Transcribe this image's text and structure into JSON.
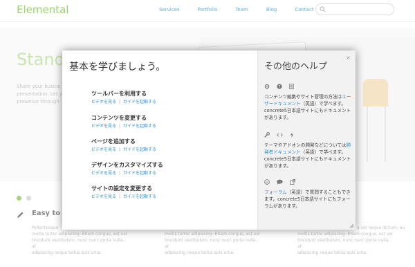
{
  "site": {
    "logo": "Elemental",
    "nav": [
      "Services",
      "Portfolio",
      "Team",
      "Blog",
      "Contact"
    ],
    "hero_title": "Stand O",
    "hero_lines": [
      "Share your busine",
      "presentation. Let y",
      "presence through"
    ],
    "feature_heading": "Easy to I",
    "columns": [
      [
        "Pellentesque",
        "mollis tortor adipiscing. Etiam congue, est vel",
        "tincidunt vestibulum, nunc nunc porta nulla, at",
        "adipiscing neque tellus quis urna."
      ],
      [
        "mollis tortor adipiscing. Etiam congue, est vel",
        "tincidunt vestibulum, nunc nunc porta nulla, at",
        "adipiscing neque tellus quis urna."
      ],
      [
        "mollis tortor adipiscing. Etiam congue, est vel",
        "tincidunt vestibulum, nunc nunc porta nulla, at",
        "adipiscing neque tellus quis urna."
      ],
      [
        "a vel neque dictum, eu",
        "mollis tortor adipiscing. Etiam congue, est vel",
        "tincidunt vestibulum, nunc nunc porta nulla, at",
        "adipiscing neque tellus quis urna."
      ]
    ]
  },
  "dialog": {
    "title": "基本を学びましょう。",
    "close": "×",
    "link_video": "ビデオを見る",
    "link_separator": "|",
    "link_guide": "ガイドを起動する",
    "tasks": [
      "ツールバーを利用する",
      "コンテンツを変更する",
      "ページを追加する",
      "デザインをカスタマイズする",
      "サイトの設定を変更する"
    ],
    "help": {
      "title": "その他のヘルプ",
      "sec1_pre": "コンテンツ編集やサイト管理の方法は",
      "sec1_link": "ユーザードキュメント",
      "sec1_post": "（英語）で学べます。concrete5日本語サイトにもドキュメントがあります。",
      "sec2_pre": "テーマやアドオンの開発などについては",
      "sec2_link": "開発者ドキュメント",
      "sec2_post": "（英語）で学べます。concrete5日本語サイトにもドキュメントがあります。",
      "sec3_link": "フォーラム",
      "sec3_post": "（英語）で質問することもできます。concrete5日本語サイトにもフォーラムがあります。"
    }
  },
  "colors": {
    "accent_green": "#9bd36b",
    "link_blue": "#2f8fd6"
  }
}
